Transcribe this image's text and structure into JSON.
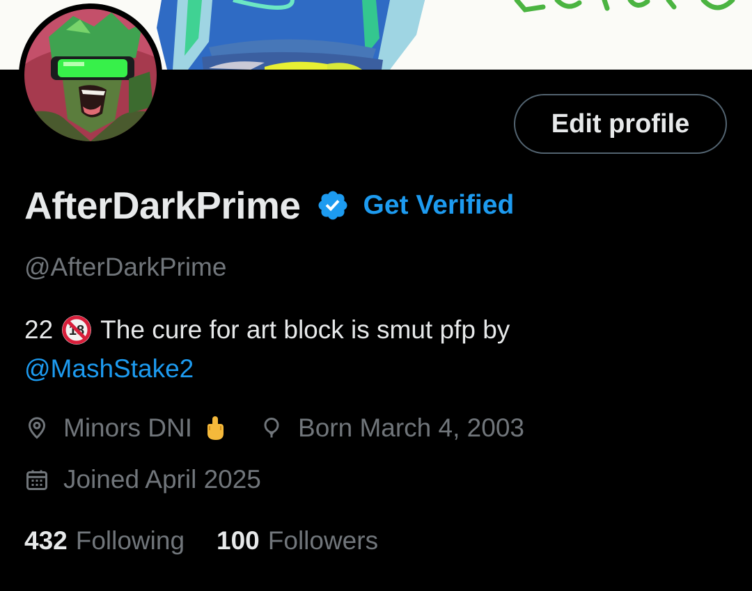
{
  "profile": {
    "edit_label": "Edit profile",
    "display_name": "AfterDarkPrime",
    "get_verified_label": "Get Verified",
    "handle": "@AfterDarkPrime",
    "bio": {
      "prefix": "22",
      "text": "The cure for art block is smut pfp by",
      "mention": "@MashStake2",
      "adult_icon": "no-under-18-icon"
    },
    "location": "Minors DNI",
    "location_emoji": "middle-finger-emoji",
    "birthday": "Born March 4, 2003",
    "joined": "Joined April 2025",
    "stats": {
      "following_count": "432",
      "following_label": "Following",
      "followers_count": "100",
      "followers_label": "Followers"
    }
  },
  "colors": {
    "background": "#000000",
    "text": "#e7e9ea",
    "muted": "#71767b",
    "accent": "#1d9bf0",
    "button_border": "#536471"
  }
}
